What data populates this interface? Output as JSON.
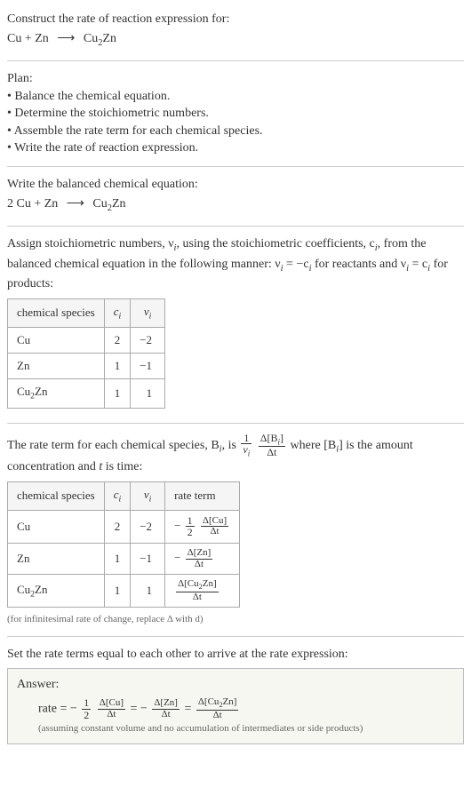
{
  "header": {
    "prompt": "Construct the rate of reaction expression for:",
    "equation_lhs": "Cu + Zn",
    "equation_rhs": "Cu",
    "equation_rhs_sub": "2",
    "equation_rhs_tail": "Zn"
  },
  "plan": {
    "title": "Plan:",
    "items": [
      "Balance the chemical equation.",
      "Determine the stoichiometric numbers.",
      "Assemble the rate term for each chemical species.",
      "Write the rate of reaction expression."
    ]
  },
  "balanced": {
    "intro": "Write the balanced chemical equation:",
    "lhs": "2 Cu + Zn",
    "rhs": "Cu",
    "rhs_sub": "2",
    "rhs_tail": "Zn"
  },
  "stoich": {
    "intro1": "Assign stoichiometric numbers, ν",
    "intro1_sub": "i",
    "intro2": ", using the stoichiometric coefficients, c",
    "intro2_sub": "i",
    "intro3": ", from the balanced chemical equation in the following manner: ν",
    "intro3_sub": "i",
    "intro4": " = −c",
    "intro4_sub": "i",
    "intro5": " for reactants and ν",
    "intro5_sub": "i",
    "intro6": " = c",
    "intro6_sub": "i",
    "intro7": " for products:",
    "headers": [
      "chemical species",
      "cᵢ",
      "νᵢ"
    ],
    "rows": [
      {
        "species": "Cu",
        "c": "2",
        "nu": "−2"
      },
      {
        "species": "Zn",
        "c": "1",
        "nu": "−1"
      },
      {
        "species": "Cu₂Zn",
        "c": "1",
        "nu": "1"
      }
    ]
  },
  "rate_term": {
    "intro_a": "The rate term for each chemical species, B",
    "intro_a_sub": "i",
    "intro_b": ", is ",
    "frac1_num": "1",
    "frac1_den_pre": "ν",
    "frac1_den_sub": "i",
    "frac2_num_pre": "Δ[B",
    "frac2_num_sub": "i",
    "frac2_num_post": "]",
    "frac2_den": "Δt",
    "intro_c": " where [B",
    "intro_c_sub": "i",
    "intro_d": "] is the amount concentration and ",
    "intro_t": "t",
    "intro_e": " is time:",
    "headers": [
      "chemical species",
      "cᵢ",
      "νᵢ",
      "rate term"
    ],
    "rows": [
      {
        "species": "Cu",
        "c": "2",
        "nu": "−2",
        "prefix": "−",
        "coef_num": "1",
        "coef_den": "2",
        "dnum": "Δ[Cu]",
        "dden": "Δt"
      },
      {
        "species": "Zn",
        "c": "1",
        "nu": "−1",
        "prefix": "−",
        "coef_num": "",
        "coef_den": "",
        "dnum": "Δ[Zn]",
        "dden": "Δt"
      },
      {
        "species": "Cu₂Zn",
        "c": "1",
        "nu": "1",
        "prefix": "",
        "coef_num": "",
        "coef_den": "",
        "dnum": "Δ[Cu₂Zn]",
        "dden": "Δt"
      }
    ],
    "note": "(for infinitesimal rate of change, replace Δ with d)"
  },
  "final": {
    "intro": "Set the rate terms equal to each other to arrive at the rate expression:",
    "answer_label": "Answer:",
    "rate_label": "rate = −",
    "t1_coef_num": "1",
    "t1_coef_den": "2",
    "t1_num": "Δ[Cu]",
    "t1_den": "Δt",
    "eq1": " = −",
    "t2_num": "Δ[Zn]",
    "t2_den": "Δt",
    "eq2": " = ",
    "t3_num": "Δ[Cu₂Zn]",
    "t3_den": "Δt",
    "assumption": "(assuming constant volume and no accumulation of intermediates or side products)"
  }
}
